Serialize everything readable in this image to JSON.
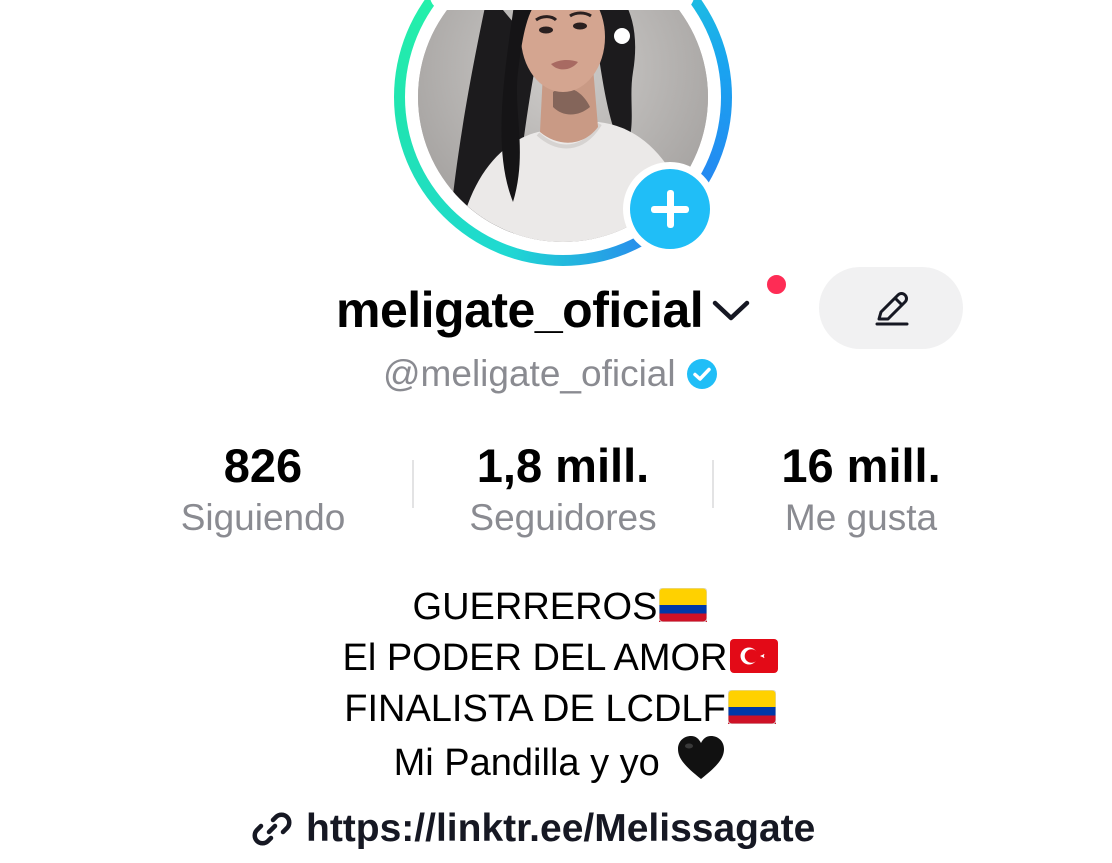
{
  "profile": {
    "display_name": "meligate_oficial",
    "handle": "@meligate_oficial",
    "verified": true,
    "avatar": "profile-photo",
    "add_icon": "plus-icon",
    "edit_icon": "pencil-icon",
    "dropdown_icon": "chevron-down-icon",
    "has_notification": true
  },
  "stats": {
    "following": {
      "value": "826",
      "label": "Siguiendo"
    },
    "followers": {
      "value": "1,8 mill.",
      "label": "Seguidores"
    },
    "likes": {
      "value": "16 mill.",
      "label": "Me gusta"
    }
  },
  "bio": {
    "lines": [
      {
        "text": "GUERREROS",
        "emoji": "flag-colombia"
      },
      {
        "text": "El PODER DEL AMOR",
        "emoji": "flag-turkey"
      },
      {
        "text": "FINALISTA DE LCDLF",
        "emoji": "flag-colombia"
      },
      {
        "text": "Mi Pandilla y yo ",
        "emoji": "black-heart"
      }
    ]
  },
  "link": {
    "url": "https://linktr.ee/Melissagate",
    "icon": "link-icon"
  },
  "colors": {
    "accent_blue": "#20bef7",
    "notification_red": "#fe2c55",
    "ring_teal": "#25f4a8",
    "ring_blue": "#2a7cf2",
    "secondary_text": "#8a8b91",
    "button_bg": "#f1f1f2"
  }
}
